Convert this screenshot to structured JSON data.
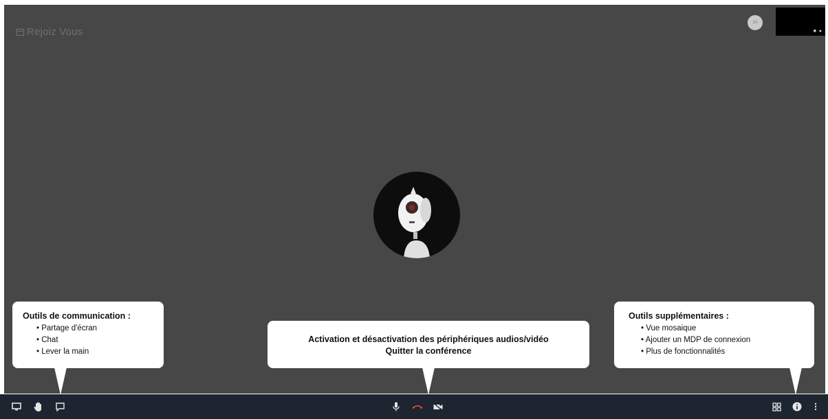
{
  "room": {
    "name": "Rejoiz Vous"
  },
  "self_view": {
    "avatar_initials": "JA",
    "thumbnail_tag": "■ ●"
  },
  "participant": {
    "avatar_icon": "robot-avatar-icon"
  },
  "toolbar": {
    "left": [
      {
        "icon": "screen-share-icon"
      },
      {
        "icon": "raise-hand-icon"
      },
      {
        "icon": "chat-icon"
      }
    ],
    "center": [
      {
        "icon": "microphone-icon"
      },
      {
        "icon": "hangup-icon",
        "color": "#e0483b"
      },
      {
        "icon": "camera-icon"
      }
    ],
    "right": [
      {
        "icon": "tile-view-icon"
      },
      {
        "icon": "info-icon"
      },
      {
        "icon": "more-options-icon"
      }
    ]
  },
  "callouts": {
    "left": {
      "title": "Outils de communication :",
      "items": [
        "Partage d'écran",
        "Chat",
        "Lever la main"
      ]
    },
    "center": {
      "line1": "Activation et désactivation des périphériques audios/vidéo",
      "line2": "Quitter la conférence"
    },
    "right": {
      "title": "Outils supplémentaires :",
      "items": [
        "Vue mosaique",
        "Ajouter un MDP de connexion",
        "Plus de fonctionnalités"
      ]
    }
  },
  "colors": {
    "stage_bg": "#474747",
    "toolbar_bg": "#1d2530",
    "hangup": "#e0483b"
  }
}
